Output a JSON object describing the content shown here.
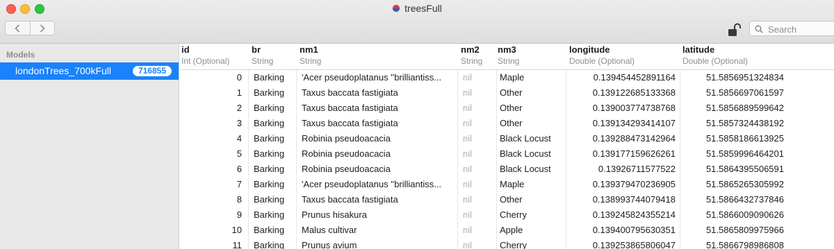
{
  "window": {
    "title": "treesFull"
  },
  "toolbar": {
    "back_icon": "chevron-left-icon",
    "forward_icon": "chevron-right-icon",
    "lock_icon": "unlocked-padlock-icon",
    "search_placeholder": "Search"
  },
  "sidebar": {
    "header": "Models",
    "items": [
      {
        "label": "londonTrees_700kFull",
        "count": "716855",
        "selected": true
      }
    ]
  },
  "table": {
    "columns": [
      {
        "name": "id",
        "type": "Int (Optional)"
      },
      {
        "name": "br",
        "type": "String"
      },
      {
        "name": "nm1",
        "type": "String"
      },
      {
        "name": "nm2",
        "type": "String"
      },
      {
        "name": "nm3",
        "type": "String"
      },
      {
        "name": "longitude",
        "type": "Double (Optional)"
      },
      {
        "name": "latitude",
        "type": "Double (Optional)"
      }
    ],
    "rows": [
      [
        "0",
        "Barking",
        "'Acer pseudoplatanus ''brilliantiss...",
        "nil",
        "Maple",
        "0.139454452891164",
        "51.5856951324834"
      ],
      [
        "1",
        "Barking",
        "Taxus baccata fastigiata",
        "nil",
        "Other",
        "0.139122685133368",
        "51.5856697061597"
      ],
      [
        "2",
        "Barking",
        "Taxus baccata fastigiata",
        "nil",
        "Other",
        "0.139003774738768",
        "51.5856889599642"
      ],
      [
        "3",
        "Barking",
        "Taxus baccata fastigiata",
        "nil",
        "Other",
        "0.139134293414107",
        "51.5857324438192"
      ],
      [
        "4",
        "Barking",
        "Robinia pseudoacacia",
        "nil",
        "Black Locust",
        "0.139288473142964",
        "51.5858186613925"
      ],
      [
        "5",
        "Barking",
        "Robinia pseudoacacia",
        "nil",
        "Black Locust",
        "0.139177159626261",
        "51.5859996464201"
      ],
      [
        "6",
        "Barking",
        "Robinia pseudoacacia",
        "nil",
        "Black Locust",
        "0.13926711577522",
        "51.5864395506591"
      ],
      [
        "7",
        "Barking",
        "'Acer pseudoplatanus ''brilliantiss...",
        "nil",
        "Maple",
        "0.139379470236905",
        "51.5865265305992"
      ],
      [
        "8",
        "Barking",
        "Taxus baccata fastigiata",
        "nil",
        "Other",
        "0.138993744079418",
        "51.5866432737846"
      ],
      [
        "9",
        "Barking",
        "Prunus hisakura",
        "nil",
        "Cherry",
        "0.139245824355214",
        "51.5866009090626"
      ],
      [
        "10",
        "Barking",
        "Malus cultivar",
        "nil",
        "Apple",
        "0.139400795630351",
        "51.5865809975966"
      ],
      [
        "11",
        "Barking",
        "Prunus avium",
        "nil",
        "Cherry",
        "0.139253865806047",
        "51.5866798986808"
      ]
    ]
  },
  "colors": {
    "selection": "#1a82fb",
    "nil_text": "#b0b0b0",
    "type_text": "#8e8e93"
  }
}
